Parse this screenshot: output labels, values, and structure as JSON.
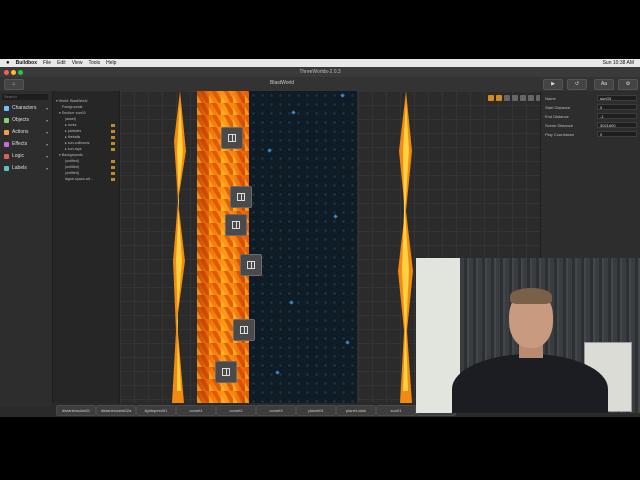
{
  "menubar": {
    "app": "Buildbox",
    "items": [
      "File",
      "Edit",
      "View",
      "Tools",
      "Help"
    ],
    "clock": "Sun 10:38 AM"
  },
  "window": {
    "title": "ThreeWorlds-2.0.3"
  },
  "toolbar": {
    "doc_title": "BlastWorld",
    "right_buttons": [
      "▶",
      "↺",
      "Aa",
      "⚙"
    ]
  },
  "sidebar": {
    "search_placeholder": "Search",
    "items": [
      {
        "label": "Characters",
        "icon": "character-icon",
        "color": "#6ac3ff"
      },
      {
        "label": "Objects",
        "icon": "cube-icon",
        "color": "#8ad06a"
      },
      {
        "label": "Actions",
        "icon": "action-icon",
        "color": "#f0a040"
      },
      {
        "label": "Effects",
        "icon": "sparkle-icon",
        "color": "#c86ae0"
      },
      {
        "label": "Logic",
        "icon": "logic-icon",
        "color": "#e06060"
      },
      {
        "label": "Labels",
        "icon": "label-icon",
        "color": "#60c0c0"
      }
    ]
  },
  "tree": {
    "rows": [
      {
        "label": "▾ World: BlastWorld",
        "indent": 0,
        "lock": false
      },
      {
        "label": "Foregrounds",
        "indent": 2,
        "lock": false
      },
      {
        "label": "▾ Section: sun03",
        "indent": 1,
        "lock": false
      },
      {
        "label": "(asset)",
        "indent": 3,
        "lock": false
      },
      {
        "label": "▸ rocks",
        "indent": 3,
        "lock": true
      },
      {
        "label": "▸ particles",
        "indent": 3,
        "lock": true
      },
      {
        "label": "▸ fireballs",
        "indent": 3,
        "lock": true
      },
      {
        "label": "▸ sun-collisions",
        "indent": 3,
        "lock": true
      },
      {
        "label": "▸ sun-rays",
        "indent": 3,
        "lock": true
      },
      {
        "label": "▾ Backgrounds",
        "indent": 1,
        "lock": false
      },
      {
        "label": "(untitled)",
        "indent": 3,
        "lock": true
      },
      {
        "label": "(untitled)",
        "indent": 3,
        "lock": true
      },
      {
        "label": "(untitled)",
        "indent": 3,
        "lock": true
      },
      {
        "label": "lagoe-space-art...",
        "indent": 3,
        "lock": true
      }
    ]
  },
  "inspector": {
    "props": [
      {
        "label": "Name",
        "value": "sun03"
      },
      {
        "label": "Start Distance",
        "value": "0"
      },
      {
        "label": "End Distance",
        "value": "-1"
      },
      {
        "label": "Scene Distance",
        "value": "3021600"
      },
      {
        "label": "Play Countdown",
        "value": "0"
      }
    ]
  },
  "canvas_tools": {
    "colors": [
      "#d88a20",
      "#d88a20",
      "#666",
      "#666",
      "#666",
      "#666",
      "#666"
    ]
  },
  "scene_tabs": [
    "distantmodes01",
    "distantmodes02a",
    "lightspeed01",
    "comet1",
    "comet2",
    "comet3",
    "planet01",
    "planet-dark",
    "sun01",
    "sun02"
  ],
  "colors": {
    "lava": "#f47a0a",
    "space": "#0f1c26",
    "accent": "#d88a20"
  }
}
